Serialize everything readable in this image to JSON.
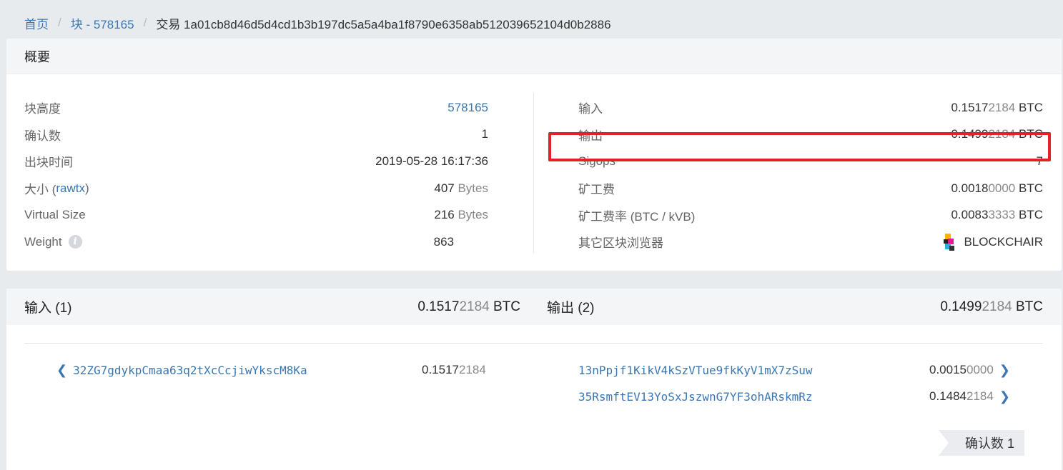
{
  "breadcrumb": {
    "home": "首页",
    "block": "块 - 578165",
    "current": "交易 1a01cb8d46d5d4cd1b3b197dc5a5a4ba1f8790e6358ab512039652104d0b2886"
  },
  "summary": {
    "title": "概要",
    "left": [
      {
        "label": "块高度",
        "value": "578165"
      },
      {
        "label": "确认数",
        "value": "1"
      },
      {
        "label": "出块时间",
        "value": "2019-05-28 16:17:36"
      },
      {
        "label_pre": "大小 (",
        "label_link": "rawtx",
        "label_post": ")",
        "value": "407",
        "unit": " Bytes"
      },
      {
        "label": "Virtual Size",
        "value": "216",
        "unit": " Bytes"
      },
      {
        "label": "Weight",
        "info_icon": "info-icon",
        "info_glyph": "i",
        "value": "863"
      }
    ],
    "right": [
      {
        "label": "输入",
        "value_main": "0.1517",
        "value_dim": "2184",
        "unit": " BTC"
      },
      {
        "label": "输出",
        "value_main": "0.1499",
        "value_dim": "2184",
        "unit": " BTC"
      },
      {
        "label": "Sigops",
        "value": "7"
      },
      {
        "label": "矿工费",
        "value_main": "0.0018",
        "value_dim": "0000",
        "unit": " BTC"
      },
      {
        "label": "矿工费率 (BTC / kVB)",
        "value_main": "0.0083",
        "value_dim": "3333",
        "unit": " BTC"
      },
      {
        "label": "其它区块浏览器",
        "value": "BLOCKCHAIR",
        "icon": "blockchair-logo-icon"
      }
    ]
  },
  "transactions": {
    "inputs_title": "输入 (1)",
    "inputs_total_main": "0.1517",
    "inputs_total_dim": "2184",
    "outputs_title": "输出 (2)",
    "outputs_total_main": "0.1499",
    "outputs_total_dim": "2184",
    "unit": " BTC",
    "inputs": [
      {
        "address": "32ZG7gdykpCmaa63q2tXcCcjiwYkscM8Ka",
        "amount_main": "0.1517",
        "amount_dim": "2184",
        "icon": "chevron-left-icon",
        "glyph": "❮"
      }
    ],
    "outputs": [
      {
        "address": "13nPpjf1KikV4kSzVTue9fkKyV1mX7zSuw",
        "amount_main": "0.0015",
        "amount_dim": "0000",
        "icon": "chevron-right-icon",
        "glyph": "❯"
      },
      {
        "address": "35RsmftEV13YoSxJszwnG7YF3ohARskmRz",
        "amount_main": "0.1484",
        "amount_dim": "2184",
        "icon": "chevron-right-icon",
        "glyph": "❯"
      }
    ],
    "confirmations_badge": "确认数 1"
  },
  "colors": {
    "link": "#3a76b2",
    "highlight": "#e32227"
  }
}
